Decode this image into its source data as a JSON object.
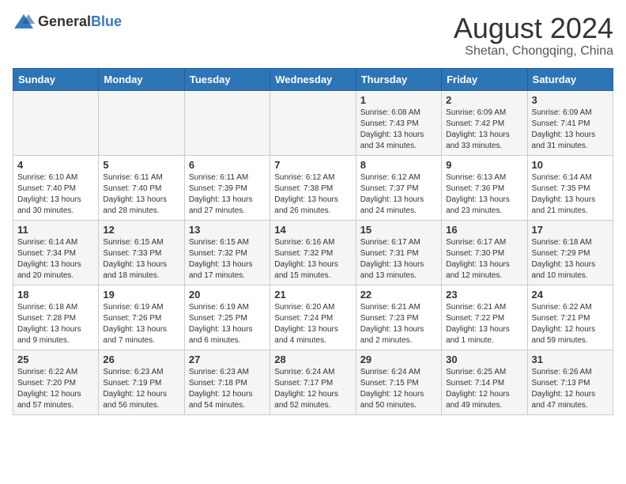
{
  "logo": {
    "general": "General",
    "blue": "Blue"
  },
  "header": {
    "month": "August 2024",
    "location": "Shetan, Chongqing, China"
  },
  "weekdays": [
    "Sunday",
    "Monday",
    "Tuesday",
    "Wednesday",
    "Thursday",
    "Friday",
    "Saturday"
  ],
  "weeks": [
    [
      {
        "day": "",
        "info": ""
      },
      {
        "day": "",
        "info": ""
      },
      {
        "day": "",
        "info": ""
      },
      {
        "day": "",
        "info": ""
      },
      {
        "day": "1",
        "info": "Sunrise: 6:08 AM\nSunset: 7:43 PM\nDaylight: 13 hours\nand 34 minutes."
      },
      {
        "day": "2",
        "info": "Sunrise: 6:09 AM\nSunset: 7:42 PM\nDaylight: 13 hours\nand 33 minutes."
      },
      {
        "day": "3",
        "info": "Sunrise: 6:09 AM\nSunset: 7:41 PM\nDaylight: 13 hours\nand 31 minutes."
      }
    ],
    [
      {
        "day": "4",
        "info": "Sunrise: 6:10 AM\nSunset: 7:40 PM\nDaylight: 13 hours\nand 30 minutes."
      },
      {
        "day": "5",
        "info": "Sunrise: 6:11 AM\nSunset: 7:40 PM\nDaylight: 13 hours\nand 28 minutes."
      },
      {
        "day": "6",
        "info": "Sunrise: 6:11 AM\nSunset: 7:39 PM\nDaylight: 13 hours\nand 27 minutes."
      },
      {
        "day": "7",
        "info": "Sunrise: 6:12 AM\nSunset: 7:38 PM\nDaylight: 13 hours\nand 26 minutes."
      },
      {
        "day": "8",
        "info": "Sunrise: 6:12 AM\nSunset: 7:37 PM\nDaylight: 13 hours\nand 24 minutes."
      },
      {
        "day": "9",
        "info": "Sunrise: 6:13 AM\nSunset: 7:36 PM\nDaylight: 13 hours\nand 23 minutes."
      },
      {
        "day": "10",
        "info": "Sunrise: 6:14 AM\nSunset: 7:35 PM\nDaylight: 13 hours\nand 21 minutes."
      }
    ],
    [
      {
        "day": "11",
        "info": "Sunrise: 6:14 AM\nSunset: 7:34 PM\nDaylight: 13 hours\nand 20 minutes."
      },
      {
        "day": "12",
        "info": "Sunrise: 6:15 AM\nSunset: 7:33 PM\nDaylight: 13 hours\nand 18 minutes."
      },
      {
        "day": "13",
        "info": "Sunrise: 6:15 AM\nSunset: 7:32 PM\nDaylight: 13 hours\nand 17 minutes."
      },
      {
        "day": "14",
        "info": "Sunrise: 6:16 AM\nSunset: 7:32 PM\nDaylight: 13 hours\nand 15 minutes."
      },
      {
        "day": "15",
        "info": "Sunrise: 6:17 AM\nSunset: 7:31 PM\nDaylight: 13 hours\nand 13 minutes."
      },
      {
        "day": "16",
        "info": "Sunrise: 6:17 AM\nSunset: 7:30 PM\nDaylight: 13 hours\nand 12 minutes."
      },
      {
        "day": "17",
        "info": "Sunrise: 6:18 AM\nSunset: 7:29 PM\nDaylight: 13 hours\nand 10 minutes."
      }
    ],
    [
      {
        "day": "18",
        "info": "Sunrise: 6:18 AM\nSunset: 7:28 PM\nDaylight: 13 hours\nand 9 minutes."
      },
      {
        "day": "19",
        "info": "Sunrise: 6:19 AM\nSunset: 7:26 PM\nDaylight: 13 hours\nand 7 minutes."
      },
      {
        "day": "20",
        "info": "Sunrise: 6:19 AM\nSunset: 7:25 PM\nDaylight: 13 hours\nand 6 minutes."
      },
      {
        "day": "21",
        "info": "Sunrise: 6:20 AM\nSunset: 7:24 PM\nDaylight: 13 hours\nand 4 minutes."
      },
      {
        "day": "22",
        "info": "Sunrise: 6:21 AM\nSunset: 7:23 PM\nDaylight: 13 hours\nand 2 minutes."
      },
      {
        "day": "23",
        "info": "Sunrise: 6:21 AM\nSunset: 7:22 PM\nDaylight: 13 hours\nand 1 minute."
      },
      {
        "day": "24",
        "info": "Sunrise: 6:22 AM\nSunset: 7:21 PM\nDaylight: 12 hours\nand 59 minutes."
      }
    ],
    [
      {
        "day": "25",
        "info": "Sunrise: 6:22 AM\nSunset: 7:20 PM\nDaylight: 12 hours\nand 57 minutes."
      },
      {
        "day": "26",
        "info": "Sunrise: 6:23 AM\nSunset: 7:19 PM\nDaylight: 12 hours\nand 56 minutes."
      },
      {
        "day": "27",
        "info": "Sunrise: 6:23 AM\nSunset: 7:18 PM\nDaylight: 12 hours\nand 54 minutes."
      },
      {
        "day": "28",
        "info": "Sunrise: 6:24 AM\nSunset: 7:17 PM\nDaylight: 12 hours\nand 52 minutes."
      },
      {
        "day": "29",
        "info": "Sunrise: 6:24 AM\nSunset: 7:15 PM\nDaylight: 12 hours\nand 50 minutes."
      },
      {
        "day": "30",
        "info": "Sunrise: 6:25 AM\nSunset: 7:14 PM\nDaylight: 12 hours\nand 49 minutes."
      },
      {
        "day": "31",
        "info": "Sunrise: 6:26 AM\nSunset: 7:13 PM\nDaylight: 12 hours\nand 47 minutes."
      }
    ]
  ]
}
